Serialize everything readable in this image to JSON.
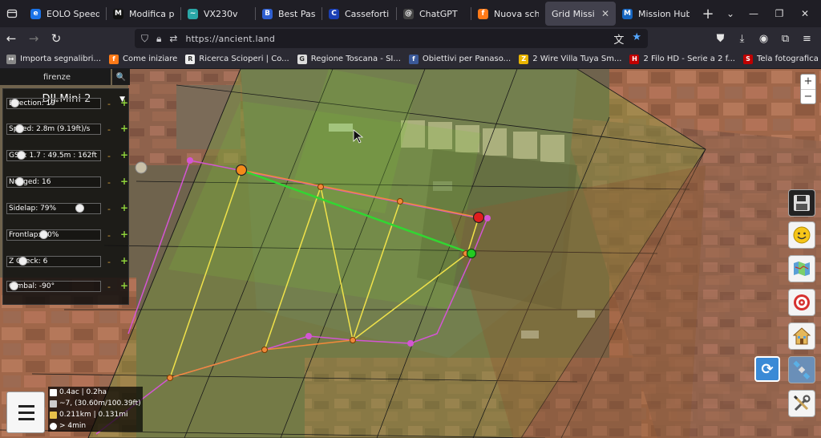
{
  "browser": {
    "tabs": [
      {
        "title": "EOLO Speed te",
        "fav": "#1a73e8",
        "glyph": "e"
      },
      {
        "title": "Modifica pagin",
        "fav": "#111111",
        "glyph": "M"
      },
      {
        "title": "VX230v",
        "fav": "#2aa7a7",
        "glyph": "~"
      },
      {
        "title": "Best Password",
        "fav": "#2f5fd0",
        "glyph": "B"
      },
      {
        "title": "Casseforti | C",
        "fav": "#1a3fb4",
        "glyph": "C"
      },
      {
        "title": "ChatGPT",
        "fav": "#444444",
        "glyph": "@"
      },
      {
        "title": "Nuova scheda",
        "fav": "#ff7a18",
        "glyph": "f"
      },
      {
        "title": "Grid Mission De",
        "fav": "",
        "glyph": "",
        "active": true
      },
      {
        "title": "Mission Hub -",
        "fav": "#1565c0",
        "glyph": "M"
      }
    ],
    "new_tab": "+",
    "url": "https://ancient.land",
    "bookmarks": [
      {
        "label": "Importa segnalibri...",
        "fav": "#888888",
        "glyph": "↦"
      },
      {
        "label": "Come iniziare",
        "fav": "#ff7a18",
        "glyph": "f"
      },
      {
        "label": "Ricerca Scioperi | Co...",
        "fav": "#eeeeee",
        "glyph": "R"
      },
      {
        "label": "Regione Toscana - SI...",
        "fav": "#dddddd",
        "glyph": "G"
      },
      {
        "label": "Obiettivi per Panaso...",
        "fav": "#3b5998",
        "glyph": "f"
      },
      {
        "label": "2 Wire Villa Tuya Sm...",
        "fav": "#e8b400",
        "glyph": "Z"
      },
      {
        "label": "2 Filo HD - Serie a 2 f...",
        "fav": "#c00000",
        "glyph": "H"
      },
      {
        "label": "Tela fotografica fono...",
        "fav": "#c00000",
        "glyph": "S"
      }
    ]
  },
  "search": {
    "value": "firenze",
    "button": "🔍"
  },
  "panel": {
    "drone": "DJI Mini 2",
    "rows": [
      {
        "label": "Direction: 19°",
        "knob": 0.05
      },
      {
        "label": "Speed: 2.8m (9.19ft)/s",
        "knob": 0.1
      },
      {
        "label": "GSD: 1.7 : 49.5m : 162ft",
        "knob": 0.12
      },
      {
        "label": "Nudged: 16",
        "knob": 0.1
      },
      {
        "label": "Sidelap: 79%",
        "knob": 0.8
      },
      {
        "label": "Frontlap: 60%",
        "knob": 0.38
      },
      {
        "label": "Z Check: 6",
        "knob": 0.14
      },
      {
        "label": "Gimbal: -90°",
        "knob": 0.04
      }
    ],
    "minus": "-",
    "plus": "+"
  },
  "zoom": {
    "in": "+",
    "out": "−"
  },
  "stats": [
    {
      "text": "0.4ac | 0.2ha",
      "icon": "#ffffff"
    },
    {
      "text": "~7, (30.60m/100.39ft)",
      "icon": "#cccccc"
    },
    {
      "text": "0.211km | 0.131mi",
      "icon": "#e8c14a"
    },
    {
      "text": "> 4min",
      "icon": "#ffffff"
    }
  ]
}
